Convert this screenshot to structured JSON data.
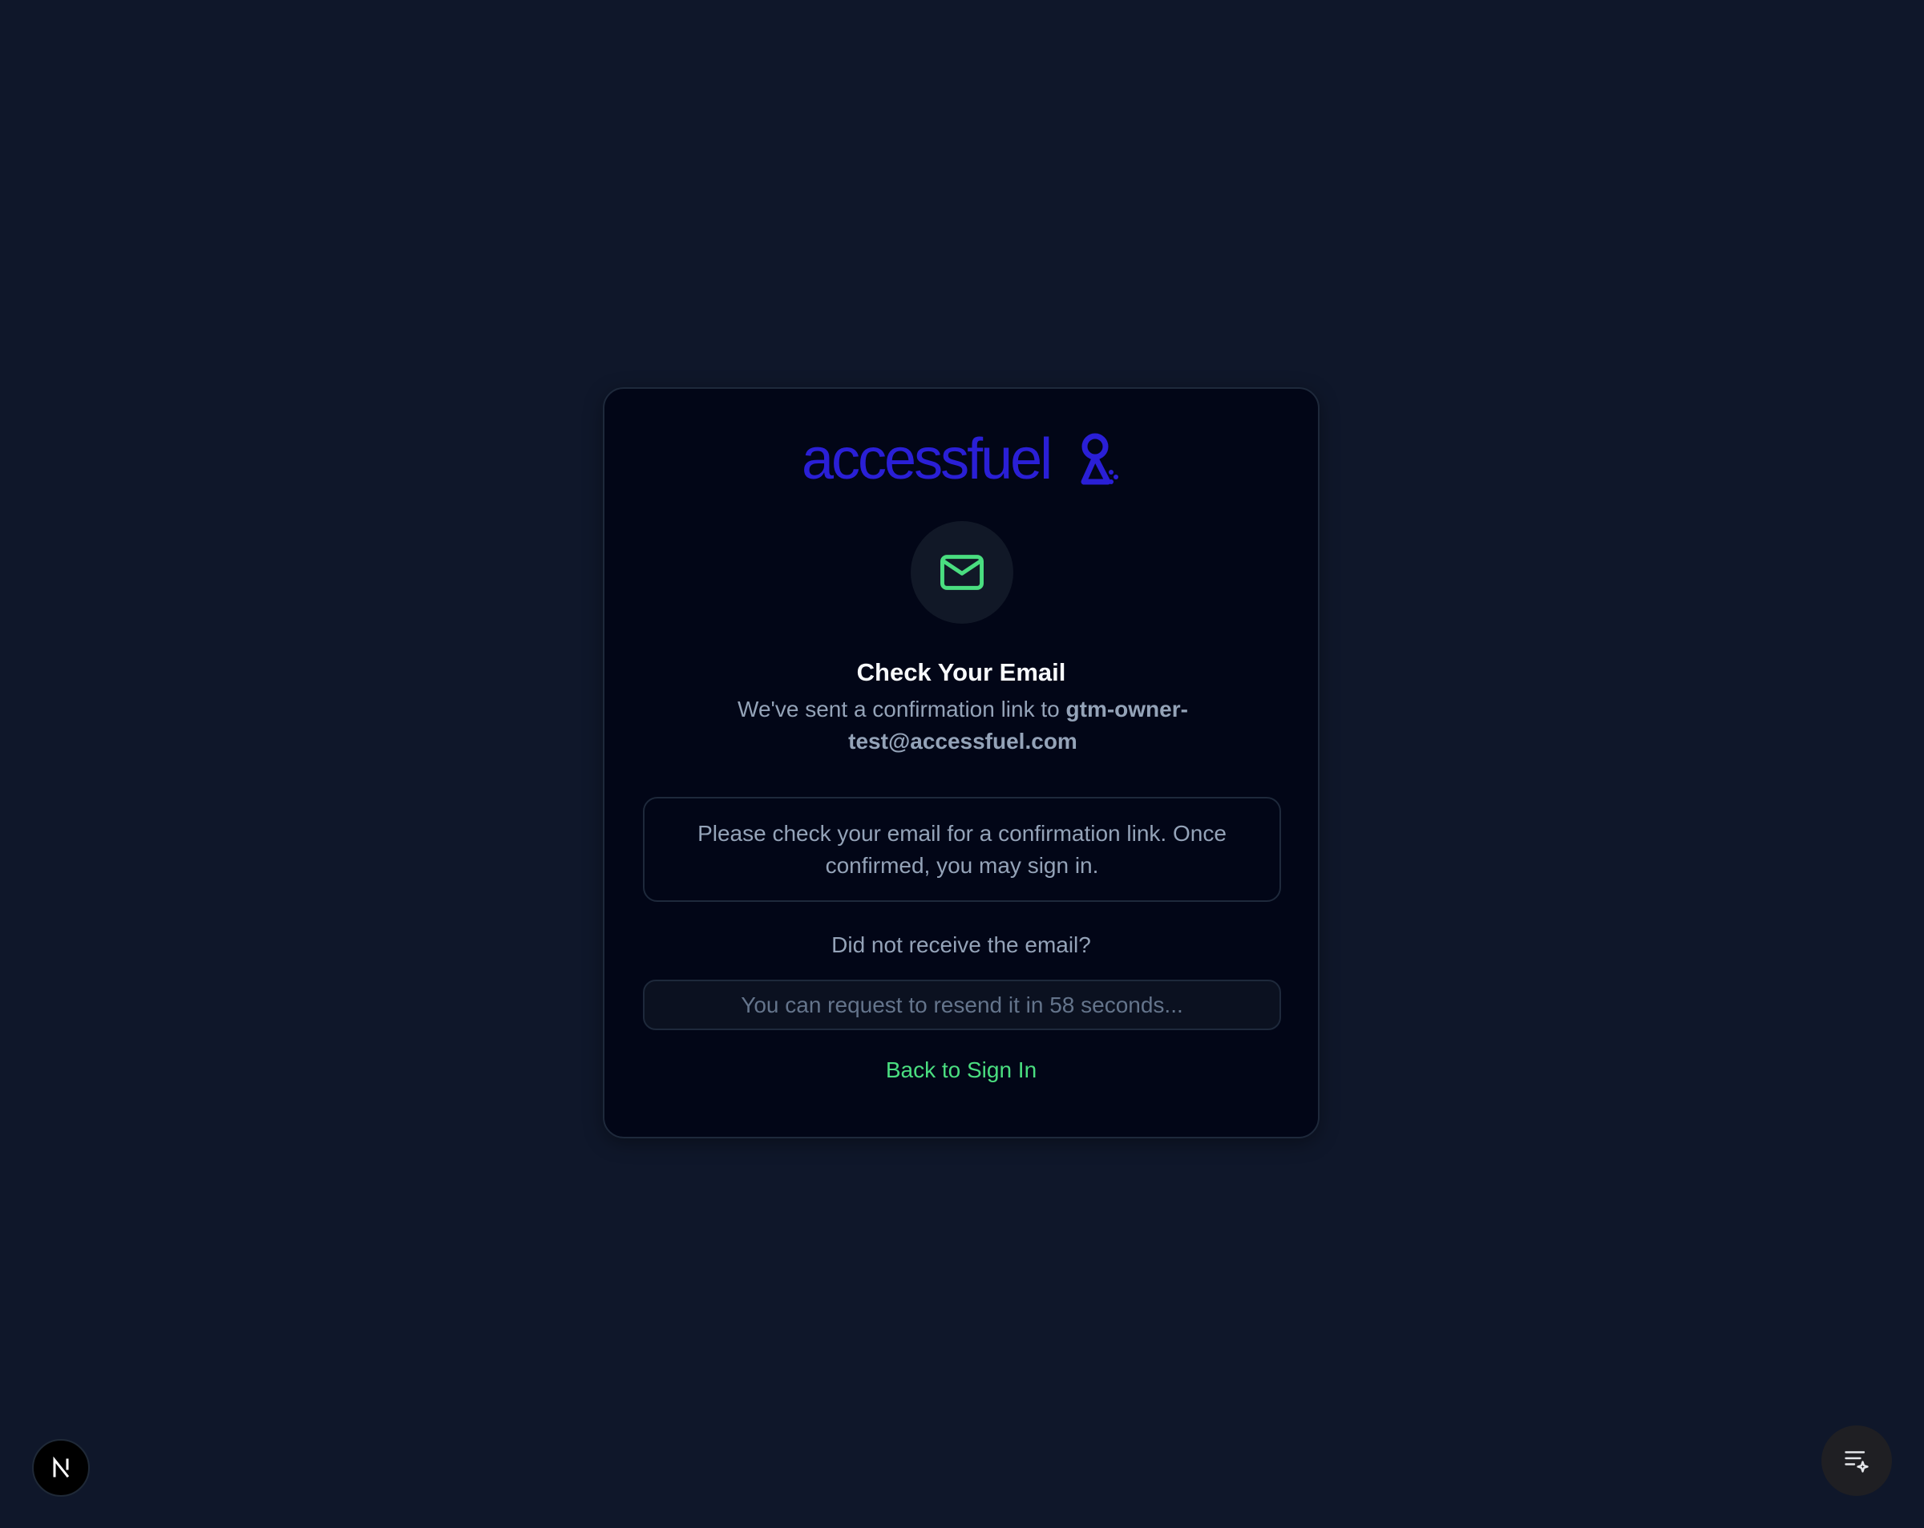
{
  "logo": {
    "text": "accessfuel"
  },
  "heading": "Check Your Email",
  "subtitle": {
    "prefix": "We've sent a confirmation link to",
    "email": "gtm-owner-test@accessfuel.com"
  },
  "notice": "Please check your email for a confirmation link. Once confirmed, you may sign in.",
  "resend_question": "Did not receive the email?",
  "resend_button": "You can request to resend it in 58 seconds...",
  "back_link": "Back to Sign In",
  "colors": {
    "background": "#0f172a",
    "card": "#020617",
    "brand": "#2a1fd6",
    "accent": "#4ade80"
  },
  "icons": {
    "mail": "mail-icon",
    "next_badge": "nextjs-n-icon",
    "fab": "list-sparkle-icon"
  }
}
